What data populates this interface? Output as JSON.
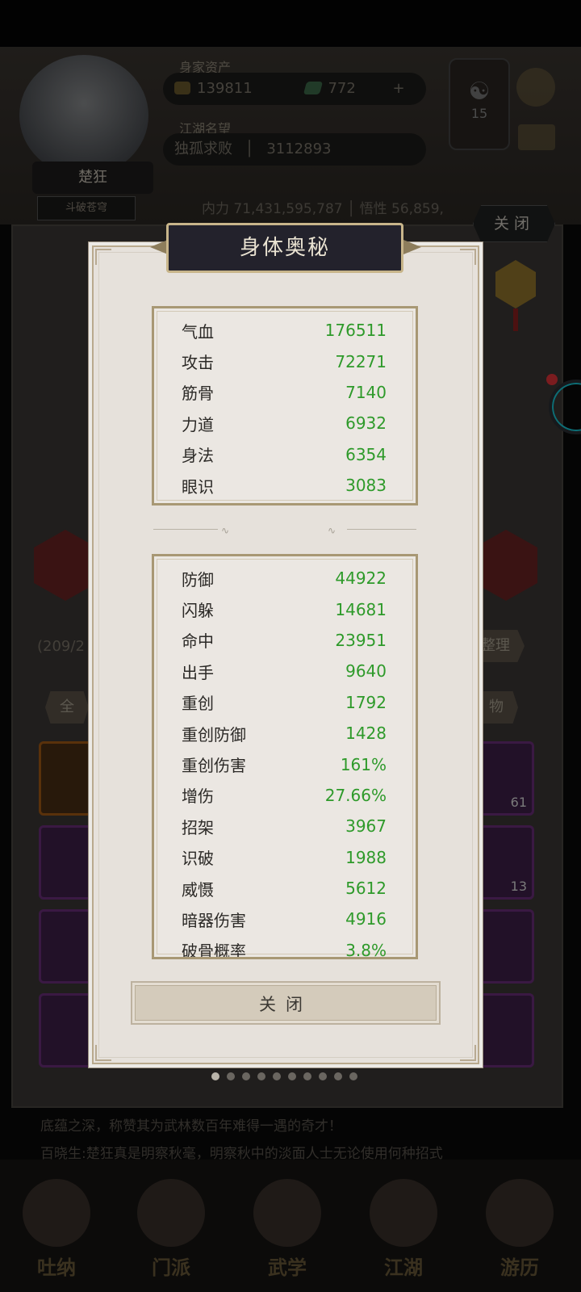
{
  "background": {
    "player": {
      "name": "楚狂",
      "rank": "斗破苍穹"
    },
    "assets_label": "身家资产",
    "gold": "139811",
    "jade": "772",
    "fame_label": "江湖名望",
    "fame_title": "独孤求败",
    "fame_value": "3112893",
    "badge_value": "15",
    "inner_power_line": "内力  71,431,595,787  │  悟性  56,859,",
    "capacity": "(209/2",
    "tidy_label": "整理",
    "tab_all": "全",
    "tab_items": "物",
    "slot_counts": [
      "61",
      "13"
    ],
    "bottom_text_1": "底蕴之深，称赞其为武林数百年难得一遇的奇才！",
    "bottom_text_2": "百晓生:楚狂真是明察秋毫，明察秋中的淡面人士无论使用何种招式",
    "nav": [
      "吐纳",
      "门派",
      "武学",
      "江湖",
      "游历"
    ],
    "top_close": "关闭"
  },
  "dialog": {
    "title": "身体奥秘",
    "primary_stats": [
      {
        "name": "气血",
        "value": "176511"
      },
      {
        "name": "攻击",
        "value": "72271"
      },
      {
        "name": "筋骨",
        "value": "7140"
      },
      {
        "name": "力道",
        "value": "6932"
      },
      {
        "name": "身法",
        "value": "6354"
      },
      {
        "name": "眼识",
        "value": "3083"
      }
    ],
    "secondary_stats": [
      {
        "name": "防御",
        "value": "44922"
      },
      {
        "name": "闪躲",
        "value": "14681"
      },
      {
        "name": "命中",
        "value": "23951"
      },
      {
        "name": "出手",
        "value": "9640"
      },
      {
        "name": "重创",
        "value": "1792"
      },
      {
        "name": "重创防御",
        "value": "1428"
      },
      {
        "name": "重创伤害",
        "value": "161%"
      },
      {
        "name": "增伤",
        "value": "27.66%"
      },
      {
        "name": "招架",
        "value": "3967"
      },
      {
        "name": "识破",
        "value": "1988"
      },
      {
        "name": "威慑",
        "value": "5612"
      },
      {
        "name": "暗器伤害",
        "value": "4916"
      },
      {
        "name": "破骨概率",
        "value": "3.8%"
      }
    ],
    "close_label": "关闭"
  },
  "pager": {
    "total": 10,
    "active": 0
  },
  "colors": {
    "stat_value": "#2e9a2a",
    "dialog_bg": "#e6e1db",
    "title_bg": "#23222c"
  }
}
